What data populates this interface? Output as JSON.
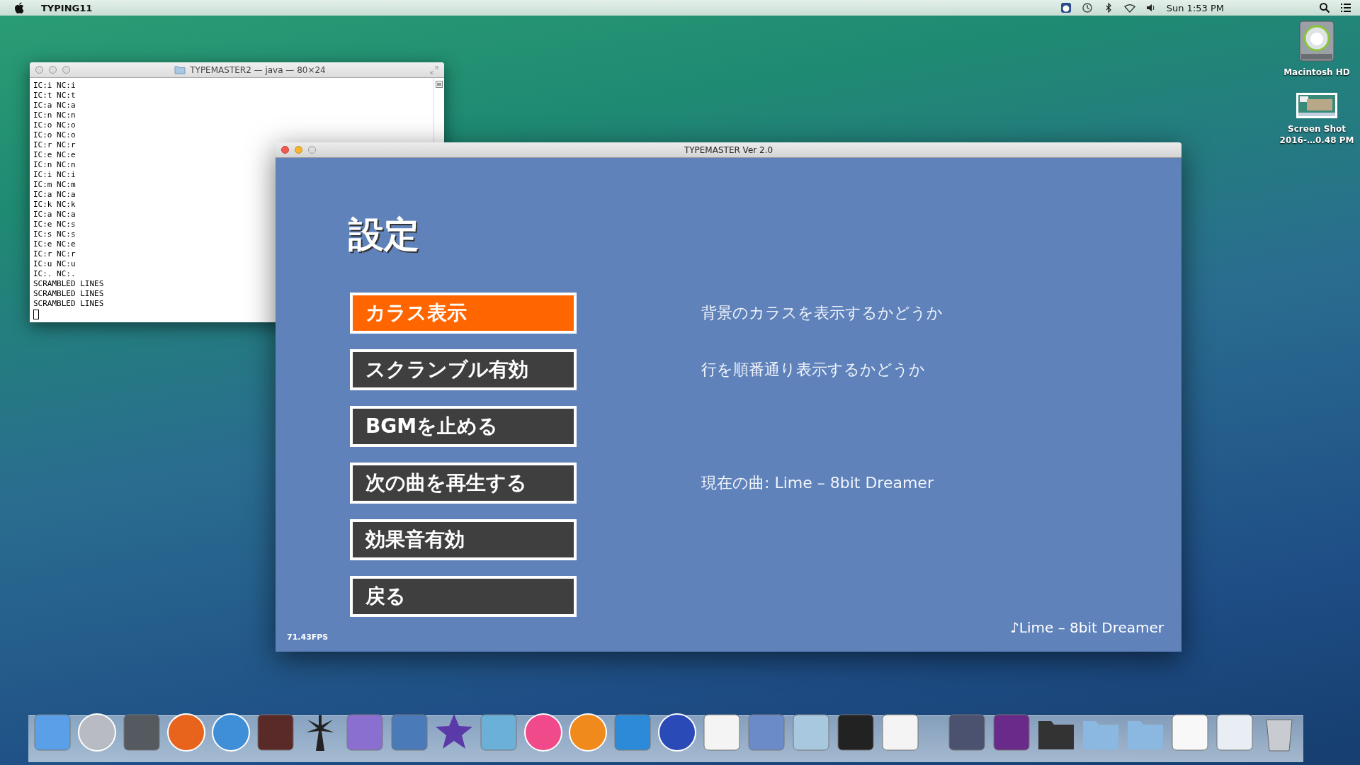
{
  "menu_bar": {
    "app_name": "TYPING11",
    "clock": "Sun 1:53 PM"
  },
  "terminal": {
    "title": "TYPEMASTER2 — java — 80×24",
    "lines": [
      "IC:i NC:i",
      "IC:t NC:t",
      "IC:a NC:a",
      "IC:n NC:n",
      "IC:o NC:o",
      "IC:o NC:o",
      "IC:r NC:r",
      "IC:e NC:e",
      "IC:n NC:n",
      "IC:i NC:i",
      "IC:m NC:m",
      "IC:a NC:a",
      "IC:k NC:k",
      "IC:a NC:a",
      "IC:e NC:s",
      "IC:s NC:s",
      "IC:e NC:e",
      "IC:r NC:r",
      "IC:u NC:u",
      "IC:. NC:.",
      "SCRAMBLED LINES",
      "SCRAMBLED LINES",
      "SCRAMBLED LINES"
    ]
  },
  "app_window": {
    "title": "TYPEMASTER Ver 2.0",
    "heading": "設定",
    "items": [
      {
        "label": "カラス表示",
        "selected": true,
        "description": "背景のカラスを表示するかどうか"
      },
      {
        "label": "スクランブル有効",
        "selected": false,
        "description": "行を順番通り表示するかどうか"
      },
      {
        "label": "BGMを止める",
        "selected": false
      },
      {
        "label": "次の曲を再生する",
        "selected": false,
        "description": "現在の曲: Lime – 8bit Dreamer"
      },
      {
        "label": "効果音有効",
        "selected": false
      },
      {
        "label": "戻る",
        "selected": false
      }
    ],
    "fps": "71.43FPS",
    "now_playing": "♪Lime – 8bit Dreamer"
  },
  "desktop_icons": [
    {
      "kind": "drive",
      "label_lines": [
        "Macintosh HD"
      ]
    },
    {
      "kind": "screenshot",
      "label_lines": [
        "Screen Shot",
        "2016-…0.48 PM"
      ]
    }
  ]
}
